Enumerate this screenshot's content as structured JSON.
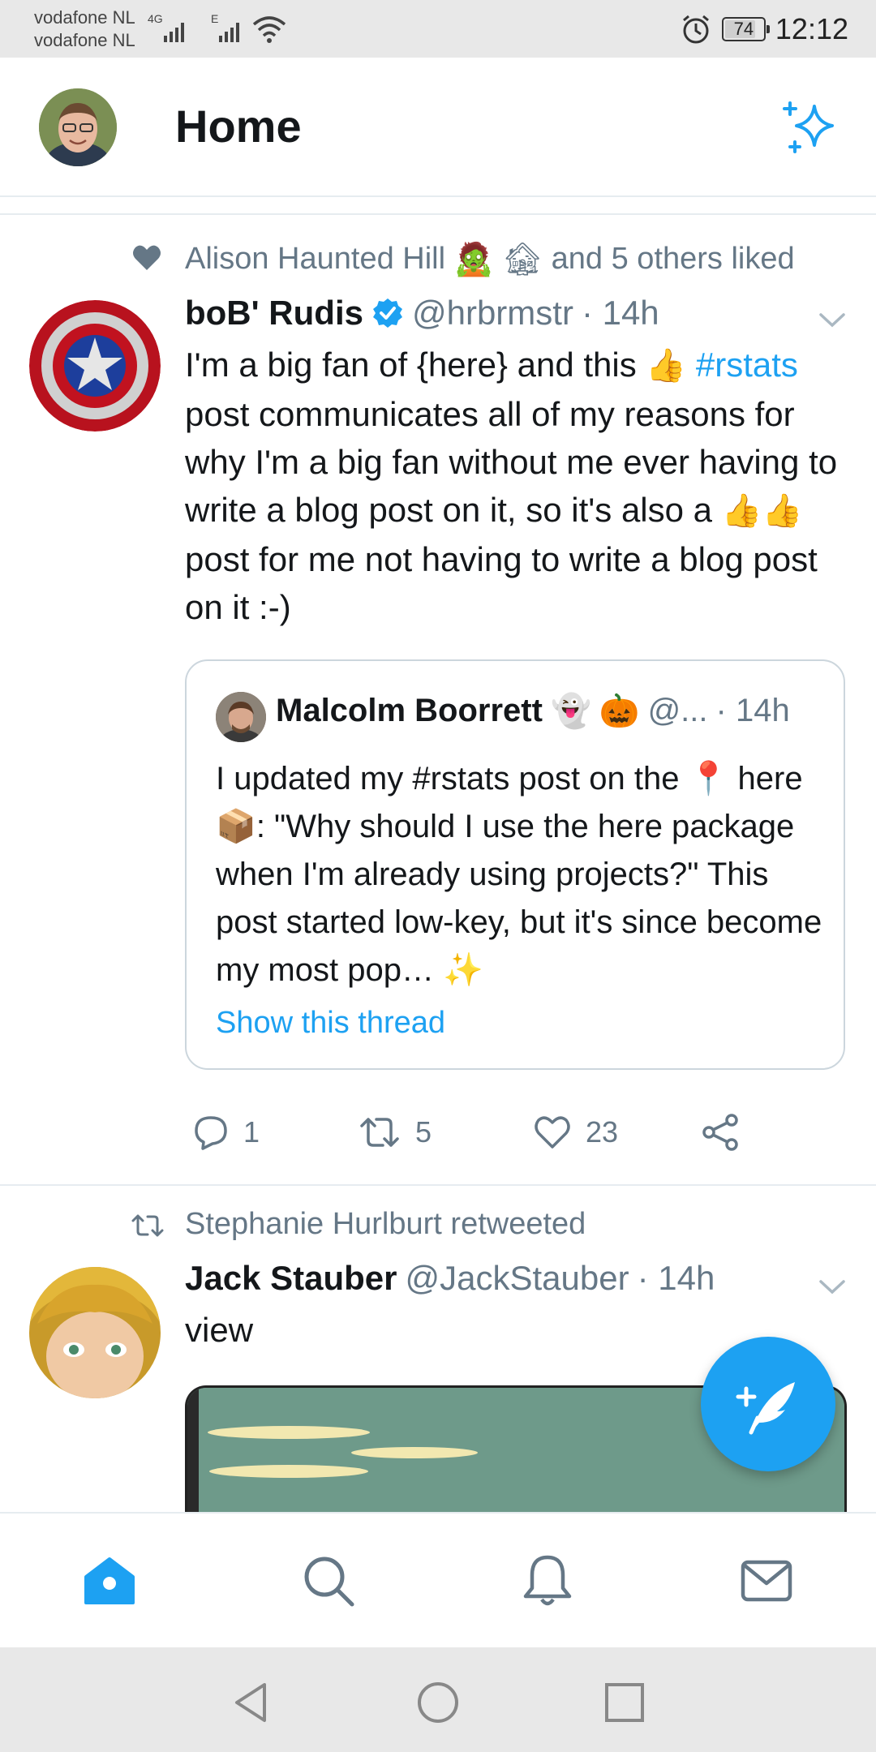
{
  "status_bar": {
    "carrier_1": "vodafone NL",
    "carrier_2": "vodafone NL",
    "network_1": "4G",
    "network_2": "E",
    "battery": "74",
    "time": "12:12"
  },
  "header": {
    "title": "Home"
  },
  "tweets": [
    {
      "social_context": "Alison Haunted Hill",
      "social_context_suffix": "and 5 others liked",
      "name": "boB' Rudis",
      "handle": "@hrbrmstr",
      "time": "· 14h",
      "body_parts": {
        "p1": "I'm a big fan of {here} and this",
        "hashtag": "#rstats",
        "p2": "post communicates all of my reasons for why I'm a big fan without me ever having to write a blog post on it, so it's also a",
        "p3": "post for me not having to write a blog post on it :-)"
      },
      "quote": {
        "name": "Malcolm Boorrett",
        "handle": "@...",
        "time": "· 14h",
        "p1": "I updated my #rstats post on the",
        "p2": "here",
        "p3": ": \"Why should I use the here package when I'm already using projects?\" This post started low-key, but it's since become my most pop…",
        "link": "Show this thread"
      },
      "actions": {
        "replies": "1",
        "retweets": "5",
        "likes": "23"
      }
    },
    {
      "social_context": "Stephanie Hurlburt retweeted",
      "name": "Jack Stauber",
      "handle": "@JackStauber",
      "time": "· 14h",
      "body": "view"
    }
  ],
  "colors": {
    "accent": "#1da1f2",
    "secondary_text": "#657786"
  },
  "icons": {
    "header_right": "sparkle-icon",
    "nav": [
      "home-icon",
      "search-icon",
      "notifications-icon",
      "messages-icon"
    ],
    "system_nav": [
      "back-icon",
      "home-circle-icon",
      "recents-icon"
    ]
  }
}
